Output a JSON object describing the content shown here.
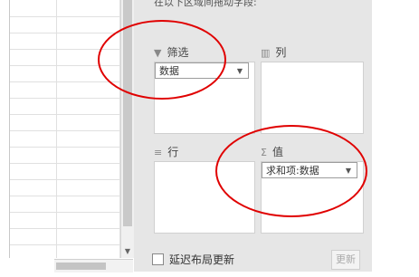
{
  "pane": {
    "header": "在以下区域间拖动字段:",
    "filter_area": {
      "label": "筛选",
      "icon": "filter-icon",
      "fields": [
        "数据"
      ]
    },
    "columns_area": {
      "label": "列",
      "icon": "columns-icon",
      "fields": []
    },
    "rows_area": {
      "label": "行",
      "icon": "rows-icon",
      "fields": []
    },
    "values_area": {
      "label": "值",
      "icon": "sigma-icon",
      "fields": [
        "求和项:数据"
      ]
    },
    "defer_update_label": "延迟布局更新",
    "update_button_label": "更新"
  },
  "glyphs": {
    "filter": "▼",
    "columns": "▥",
    "rows": "≡",
    "sigma": "Σ",
    "dropdown": "▼",
    "scroll_down": "▼"
  },
  "annotation_color": "#e00000"
}
